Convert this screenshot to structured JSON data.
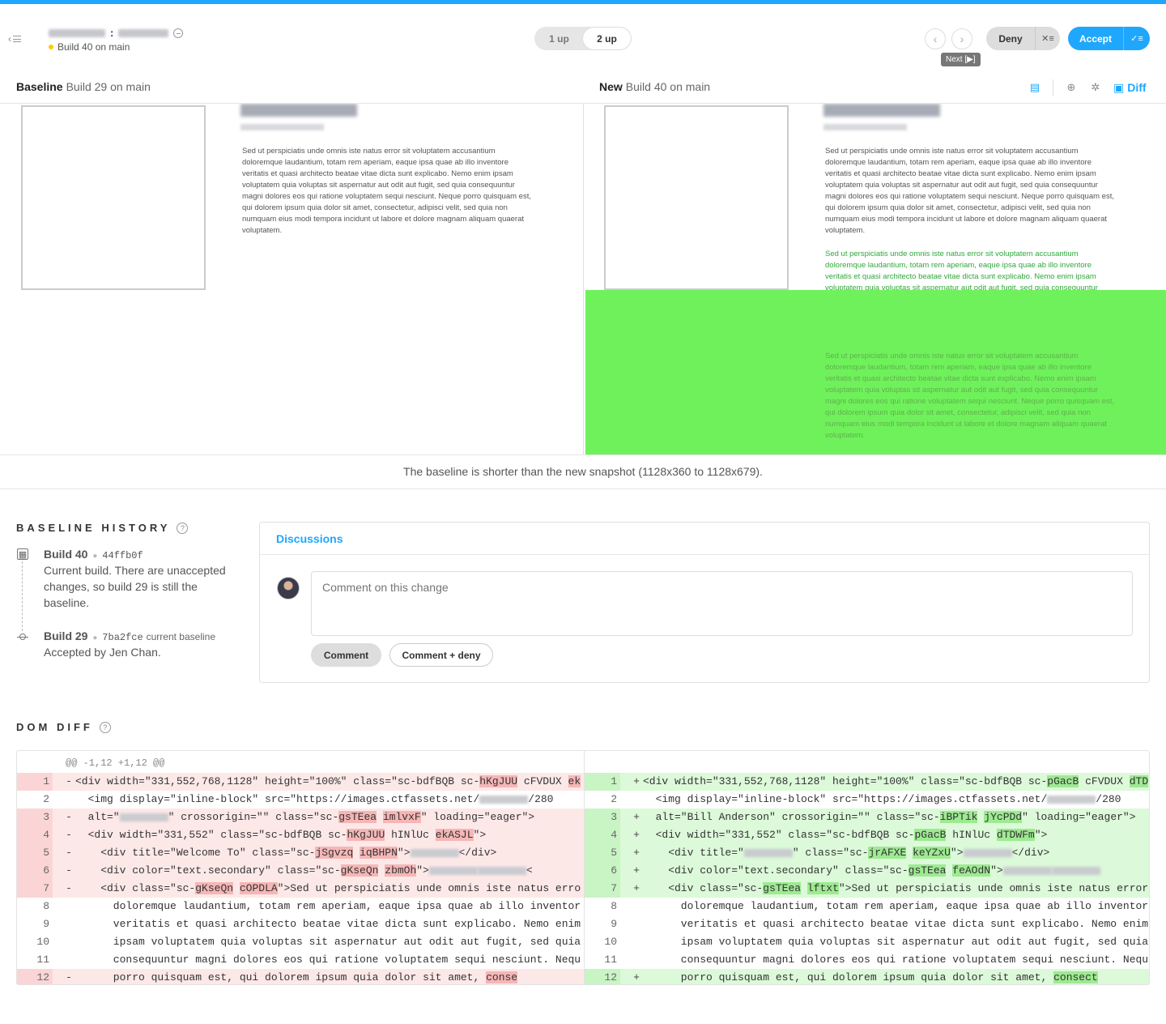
{
  "header": {
    "build_status": "Build 40 on main",
    "mode_options": [
      "1 up",
      "2 up"
    ],
    "active_mode": "2 up",
    "prev_icon": "chevron-left-icon",
    "next_icon": "chevron-right-icon",
    "next_tooltip": "Next [▶]",
    "deny_label": "Deny",
    "accept_label": "Accept",
    "colors": {
      "accent": "#1ea7fd",
      "status_dot": "#ffcc00"
    }
  },
  "compare": {
    "baseline_label": "Baseline",
    "baseline_build": "Build 29 on main",
    "new_label": "New",
    "new_build": "Build 40 on main",
    "diff_label": "Diff",
    "notice": "The baseline is shorter than the new snapshot (1128x360 to 1128x679)."
  },
  "snapshot": {
    "paragraph": "Sed ut perspiciatis unde omnis iste natus error sit voluptatem accusantium doloremque laudantium, totam rem aperiam, eaque ipsa quae ab illo inventore veritatis et quasi architecto beatae vitae dicta sunt explicabo. Nemo enim ipsam voluptatem quia voluptas sit aspernatur aut odit aut fugit, sed quia consequuntur magni dolores eos qui ratione voluptatem sequi nesciunt. Neque porro quisquam est, qui dolorem ipsum quia dolor sit amet, consectetur, adipisci velit, sed quia non numquam eius modi tempora incidunt ut labore et dolore magnam aliquam quaerat voluptatem.",
    "diff_highlight_color": "#6ff15b"
  },
  "history": {
    "title": "BASELINE HISTORY",
    "items": [
      {
        "build": "Build 40",
        "hash": "44ffb0f",
        "tag": "",
        "desc": "Current build. There are unaccepted changes, so build 29 is still the baseline."
      },
      {
        "build": "Build 29",
        "hash": "7ba2fce",
        "tag": "current baseline",
        "desc": "Accepted by Jen Chan."
      }
    ]
  },
  "discussion": {
    "title": "Discussions",
    "placeholder": "Comment on this change",
    "comment_label": "Comment",
    "comment_deny_label": "Comment + deny"
  },
  "domdiff": {
    "title": "DOM DIFF",
    "hunk": "@@ -1,12 +1,12 @@",
    "left": [
      {
        "n": "1",
        "s": "-",
        "t": "del",
        "parts": [
          [
            "<div width=\"331,552,768,1128\" height=\"100%\" class=\"sc-bdfBQB sc-",
            ""
          ],
          [
            "hKgJUU",
            "h"
          ],
          [
            " cFVDUX ",
            ""
          ],
          [
            "ek",
            "h"
          ]
        ]
      },
      {
        "n": "2",
        "s": "",
        "t": "ctx",
        "parts": [
          [
            "  <img display=\"inline-block\" src=\"https://images.ctfassets.net/",
            ""
          ],
          [
            "",
            "b"
          ],
          [
            "/280",
            ""
          ]
        ]
      },
      {
        "n": "3",
        "s": "-",
        "t": "del",
        "parts": [
          [
            "  alt=\"",
            ""
          ],
          [
            "",
            "b"
          ],
          [
            "\" crossorigin=\"\" class=\"sc-",
            ""
          ],
          [
            "gsTEea",
            "h"
          ],
          [
            " ",
            ""
          ],
          [
            "imlvxF",
            "h"
          ],
          [
            "\" loading=\"eager\">",
            ""
          ]
        ]
      },
      {
        "n": "4",
        "s": "-",
        "t": "del",
        "parts": [
          [
            "  <div width=\"331,552\" class=\"sc-bdfBQB sc-",
            ""
          ],
          [
            "hKgJUU",
            "h"
          ],
          [
            " hINlUc ",
            ""
          ],
          [
            "ekASJL",
            "h"
          ],
          [
            "\">",
            ""
          ]
        ]
      },
      {
        "n": "5",
        "s": "-",
        "t": "del",
        "parts": [
          [
            "    <div title=\"Welcome To\" class=\"sc-",
            ""
          ],
          [
            "jSgvzq",
            "h"
          ],
          [
            " ",
            ""
          ],
          [
            "iqBHPN",
            "h"
          ],
          [
            "\">",
            ""
          ],
          [
            "",
            "b"
          ],
          [
            "</div>",
            ""
          ]
        ]
      },
      {
        "n": "6",
        "s": "-",
        "t": "del",
        "parts": [
          [
            "    <div color=\"text.secondary\" class=\"sc-",
            ""
          ],
          [
            "gKseQn",
            "h"
          ],
          [
            " ",
            ""
          ],
          [
            "zbmOh",
            "h"
          ],
          [
            "\">",
            ""
          ],
          [
            "",
            "b"
          ],
          [
            "",
            "b"
          ],
          [
            "<",
            ""
          ]
        ]
      },
      {
        "n": "7",
        "s": "-",
        "t": "del",
        "parts": [
          [
            "    <div class=\"sc-",
            ""
          ],
          [
            "gKseQn",
            "h"
          ],
          [
            " ",
            ""
          ],
          [
            "cOPDLA",
            "h"
          ],
          [
            "\">Sed ut perspiciatis unde omnis iste natus erro",
            ""
          ]
        ]
      },
      {
        "n": "8",
        "s": "",
        "t": "ctx",
        "parts": [
          [
            "      doloremque laudantium, totam rem aperiam, eaque ipsa quae ab illo inventor",
            ""
          ]
        ]
      },
      {
        "n": "9",
        "s": "",
        "t": "ctx",
        "parts": [
          [
            "      veritatis et quasi architecto beatae vitae dicta sunt explicabo. Nemo enim",
            ""
          ]
        ]
      },
      {
        "n": "10",
        "s": "",
        "t": "ctx",
        "parts": [
          [
            "      ipsam voluptatem quia voluptas sit aspernatur aut odit aut fugit, sed quia",
            ""
          ]
        ]
      },
      {
        "n": "11",
        "s": "",
        "t": "ctx",
        "parts": [
          [
            "      consequuntur magni dolores eos qui ratione voluptatem sequi nesciunt. Nequ",
            ""
          ]
        ]
      },
      {
        "n": "12",
        "s": "-",
        "t": "del",
        "parts": [
          [
            "      porro quisquam est, qui dolorem ipsum quia dolor sit amet, ",
            ""
          ],
          [
            "conse",
            "h"
          ]
        ]
      }
    ],
    "right": [
      {
        "n": "1",
        "s": "+",
        "t": "add",
        "parts": [
          [
            "<div width=\"331,552,768,1128\" height=\"100%\" class=\"sc-bdfBQB sc-",
            ""
          ],
          [
            "pGacB",
            "h"
          ],
          [
            " cFVDUX ",
            ""
          ],
          [
            "dTD",
            "h"
          ]
        ]
      },
      {
        "n": "2",
        "s": "",
        "t": "ctx",
        "parts": [
          [
            "  <img display=\"inline-block\" src=\"https://images.ctfassets.net/",
            ""
          ],
          [
            "",
            "b"
          ],
          [
            "/280",
            ""
          ]
        ]
      },
      {
        "n": "3",
        "s": "+",
        "t": "add",
        "parts": [
          [
            "  alt=\"Bill Anderson\" crossorigin=\"\" class=\"sc-",
            ""
          ],
          [
            "iBPTik",
            "h"
          ],
          [
            " ",
            ""
          ],
          [
            "jYcPDd",
            "h"
          ],
          [
            "\" loading=\"eager\">",
            ""
          ]
        ]
      },
      {
        "n": "4",
        "s": "+",
        "t": "add",
        "parts": [
          [
            "  <div width=\"331,552\" class=\"sc-bdfBQB sc-",
            ""
          ],
          [
            "pGacB",
            "h"
          ],
          [
            " hINlUc ",
            ""
          ],
          [
            "dTDWFm",
            "h"
          ],
          [
            "\">",
            ""
          ]
        ]
      },
      {
        "n": "5",
        "s": "+",
        "t": "add",
        "parts": [
          [
            "    <div title=\"",
            ""
          ],
          [
            "",
            "b"
          ],
          [
            "\" class=\"sc-",
            ""
          ],
          [
            "jrAFXE",
            "h"
          ],
          [
            " ",
            ""
          ],
          [
            "keYZxU",
            "h"
          ],
          [
            "\">",
            ""
          ],
          [
            "",
            "b"
          ],
          [
            "</div>",
            ""
          ]
        ]
      },
      {
        "n": "6",
        "s": "+",
        "t": "add",
        "parts": [
          [
            "    <div color=\"text.secondary\" class=\"sc-",
            ""
          ],
          [
            "gsTEea",
            "h"
          ],
          [
            " ",
            ""
          ],
          [
            "feAOdN",
            "h"
          ],
          [
            "\">",
            ""
          ],
          [
            "",
            "b"
          ],
          [
            "",
            "b"
          ]
        ]
      },
      {
        "n": "7",
        "s": "+",
        "t": "add",
        "parts": [
          [
            "    <div class=\"sc-",
            ""
          ],
          [
            "gsTEea",
            "h"
          ],
          [
            " ",
            ""
          ],
          [
            "lftxt",
            "h"
          ],
          [
            "\">Sed ut perspiciatis unde omnis iste natus error",
            ""
          ]
        ]
      },
      {
        "n": "8",
        "s": "",
        "t": "ctx",
        "parts": [
          [
            "      doloremque laudantium, totam rem aperiam, eaque ipsa quae ab illo inventor",
            ""
          ]
        ]
      },
      {
        "n": "9",
        "s": "",
        "t": "ctx",
        "parts": [
          [
            "      veritatis et quasi architecto beatae vitae dicta sunt explicabo. Nemo enim",
            ""
          ]
        ]
      },
      {
        "n": "10",
        "s": "",
        "t": "ctx",
        "parts": [
          [
            "      ipsam voluptatem quia voluptas sit aspernatur aut odit aut fugit, sed quia",
            ""
          ]
        ]
      },
      {
        "n": "11",
        "s": "",
        "t": "ctx",
        "parts": [
          [
            "      consequuntur magni dolores eos qui ratione voluptatem sequi nesciunt. Nequ",
            ""
          ]
        ]
      },
      {
        "n": "12",
        "s": "+",
        "t": "add",
        "parts": [
          [
            "      porro quisquam est, qui dolorem ipsum quia dolor sit amet, ",
            ""
          ],
          [
            "consect",
            "h"
          ]
        ]
      }
    ]
  }
}
